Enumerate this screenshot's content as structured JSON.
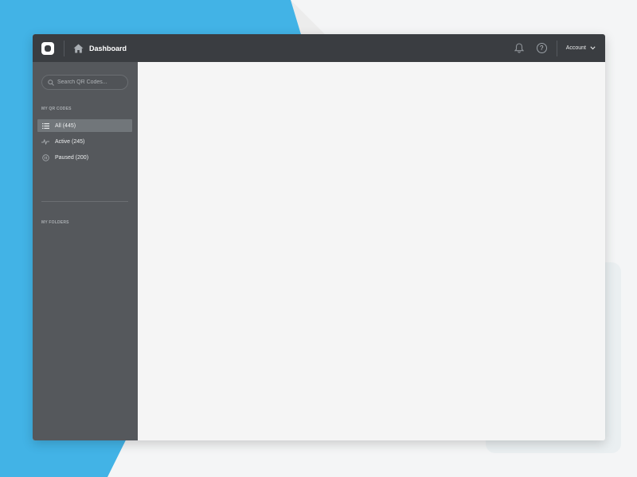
{
  "header": {
    "title": "Dashboard",
    "account_label": "Account",
    "help_label": "?"
  },
  "sidebar": {
    "search": {
      "placeholder": "Search QR Codes..."
    },
    "my_qr_codes_label": "MY QR CODES",
    "items": [
      {
        "label": "All (445)",
        "icon": "list-icon",
        "active": true
      },
      {
        "label": "Active (245)",
        "icon": "pulse-icon",
        "active": false
      },
      {
        "label": "Paused (200)",
        "icon": "pause-icon",
        "active": false
      }
    ],
    "my_folders_label": "MY FOLDERS"
  },
  "colors": {
    "topbar": "#3a3d41",
    "sidebar": "#55585c",
    "active_item": "#71767a",
    "content": "#f5f5f5",
    "background_blue": "#42b3e6"
  }
}
